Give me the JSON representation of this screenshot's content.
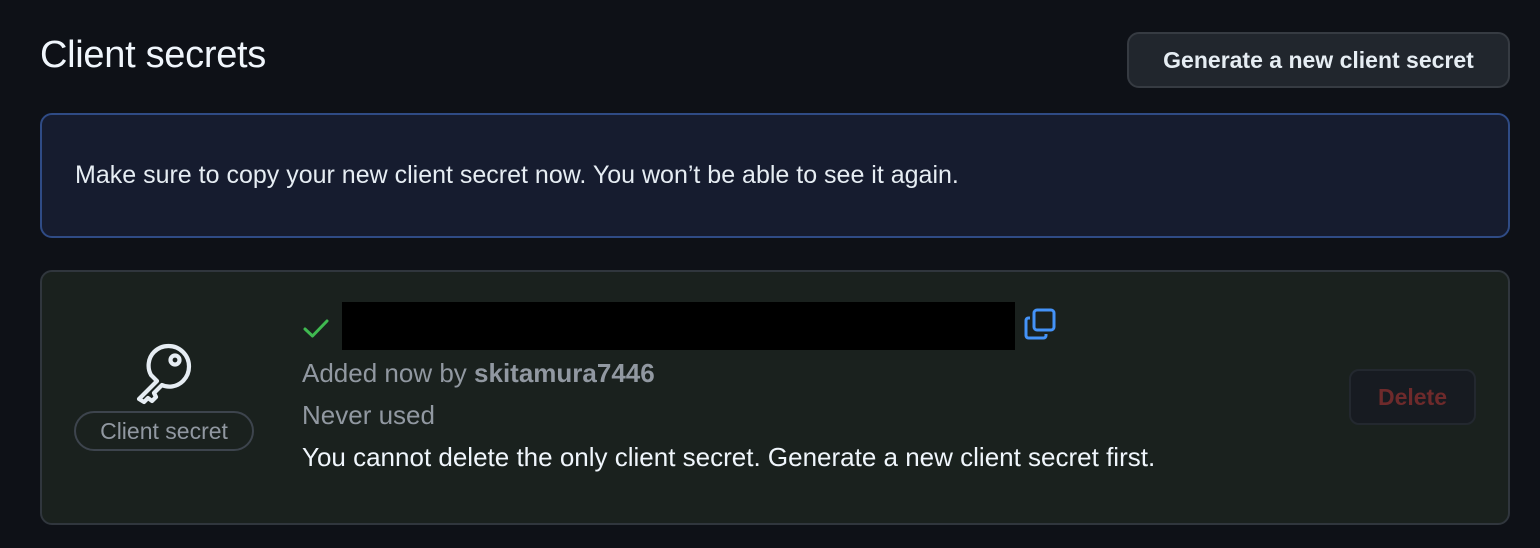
{
  "section": {
    "title": "Client secrets",
    "generate_button_label": "Generate a new client secret"
  },
  "flash": {
    "message": "Make sure to copy your new client secret now. You won’t be able to see it again."
  },
  "secret": {
    "badge_label": "Client secret",
    "value_redacted": "",
    "added_prefix": "Added now by",
    "added_by": "skitamura7446",
    "usage": "Never used",
    "note": "You cannot delete the only client secret. Generate a new client secret first.",
    "delete_button_label": "Delete",
    "icons": [
      "key-icon",
      "check-icon",
      "copy-icon"
    ]
  },
  "colors": {
    "background": "#0e1117",
    "flash_bg": "#161c2f",
    "flash_border": "#2f4b85",
    "check_green": "#3fb950",
    "copy_blue": "#4493f8",
    "danger_disabled": "#6e2a2b"
  }
}
